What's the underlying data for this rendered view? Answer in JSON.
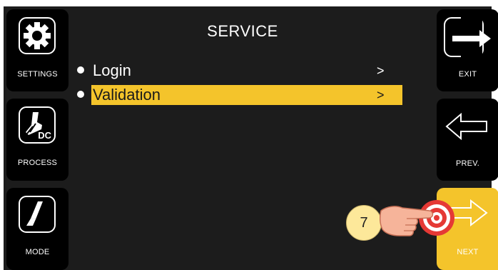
{
  "screen": {
    "title": "SERVICE"
  },
  "menu": {
    "items": [
      {
        "label": "Login",
        "arrow": ">",
        "selected": false
      },
      {
        "label": "Validation",
        "arrow": ">",
        "selected": true
      }
    ]
  },
  "left_buttons": [
    {
      "label": "SETTINGS",
      "icon": "gear-icon"
    },
    {
      "label": "PROCESS",
      "icon": "torch-dc-icon",
      "icon_text": "DC"
    },
    {
      "label": "MODE",
      "icon": "trigger-icon"
    }
  ],
  "right_buttons": [
    {
      "label": "EXIT",
      "icon": "exit-arrow-icon"
    },
    {
      "label": "PREV.",
      "icon": "left-arrow-icon"
    },
    {
      "label": "NEXT",
      "icon": "right-arrow-icon",
      "active": true
    }
  ],
  "annotation": {
    "step": "7",
    "icon": "pointing-hand-icon"
  },
  "colors": {
    "highlight": "#f4c42b",
    "panel": "#000000",
    "background": "#1c1c1c",
    "badge": "#fde89a",
    "touch": "#e53935"
  }
}
